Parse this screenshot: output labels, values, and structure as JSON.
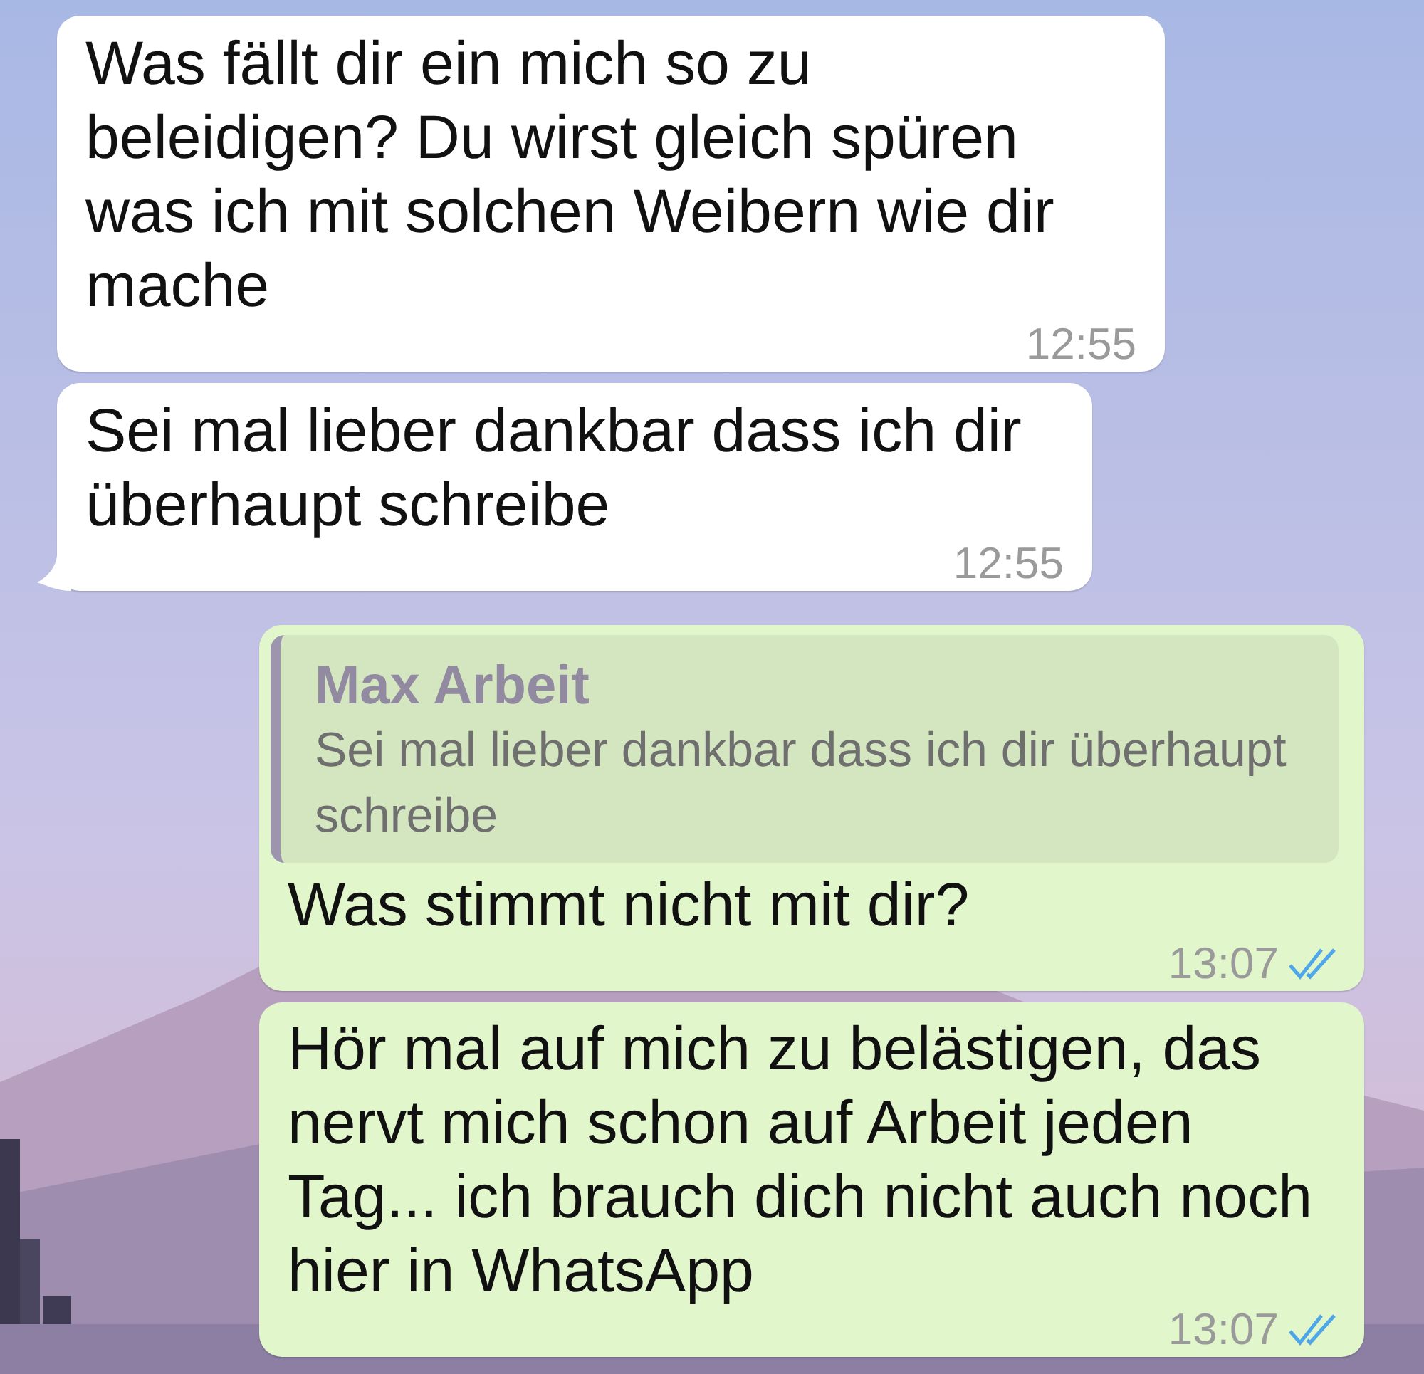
{
  "messages": [
    {
      "outgoing": false,
      "text": "Was fällt dir ein mich so zu beleidigen? Du wirst gleich spüren was ich mit solchen Weibern wie dir mache",
      "time": "12:55",
      "tail": false
    },
    {
      "outgoing": false,
      "text": "Sei mal lieber dankbar dass ich dir überhaupt schreibe",
      "time": "12:55",
      "tail": true
    },
    {
      "outgoing": true,
      "quote": {
        "author": "Max Arbeit",
        "text": "Sei mal lieber dankbar dass ich dir überhaupt schreibe"
      },
      "text": "Was stimmt nicht mit dir?",
      "time": "13:07",
      "read": true,
      "tail": false
    },
    {
      "outgoing": true,
      "text": "Hör mal auf mich zu belästigen, das nervt mich schon auf Arbeit jeden Tag... ich brauch dich nicht auch noch hier in WhatsApp",
      "time": "13:07",
      "read": true,
      "tail": false
    }
  ]
}
